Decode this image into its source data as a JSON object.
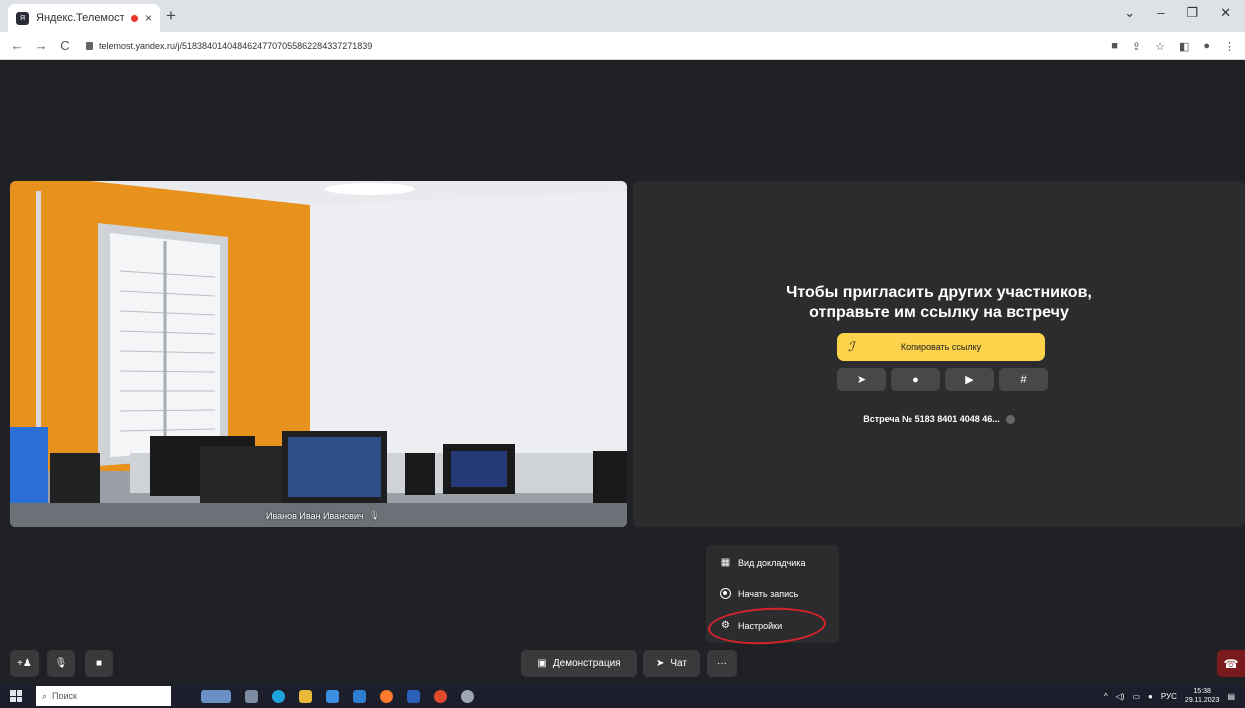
{
  "browser": {
    "tab_title": "Яндекс.Телемост",
    "favicon_text": "Я",
    "url": "telemost.yandex.ru/j/51838401404846247707055862284337271839",
    "new_tab": "+",
    "close_tab": "×"
  },
  "video": {
    "participant_name": "Иванов Иван Иванович"
  },
  "invite": {
    "title": "Чтобы пригласить других участников, отправьте им ссылку на встречу",
    "copy_link": "Копировать ссылку",
    "meeting_id": "Встреча № 5183 8401 4048 46..."
  },
  "menu": {
    "items": [
      {
        "label": "Вид докладчика",
        "icon": "presenter-view-icon"
      },
      {
        "label": "Начать запись",
        "icon": "record-icon"
      },
      {
        "label": "Настройки",
        "icon": "gear-icon"
      }
    ]
  },
  "bottom_bar": {
    "demo_label": "Демонстрация",
    "chat_label": "Чат",
    "more_label": "···"
  },
  "taskbar": {
    "search_label": "Поиск",
    "lang": "РУС",
    "time": "15:38",
    "date": "29.11.2023"
  },
  "colors": {
    "accent_yellow": "#fcd34a",
    "annotation_red": "#d8232a",
    "hangup_red": "#7a1a1d"
  }
}
